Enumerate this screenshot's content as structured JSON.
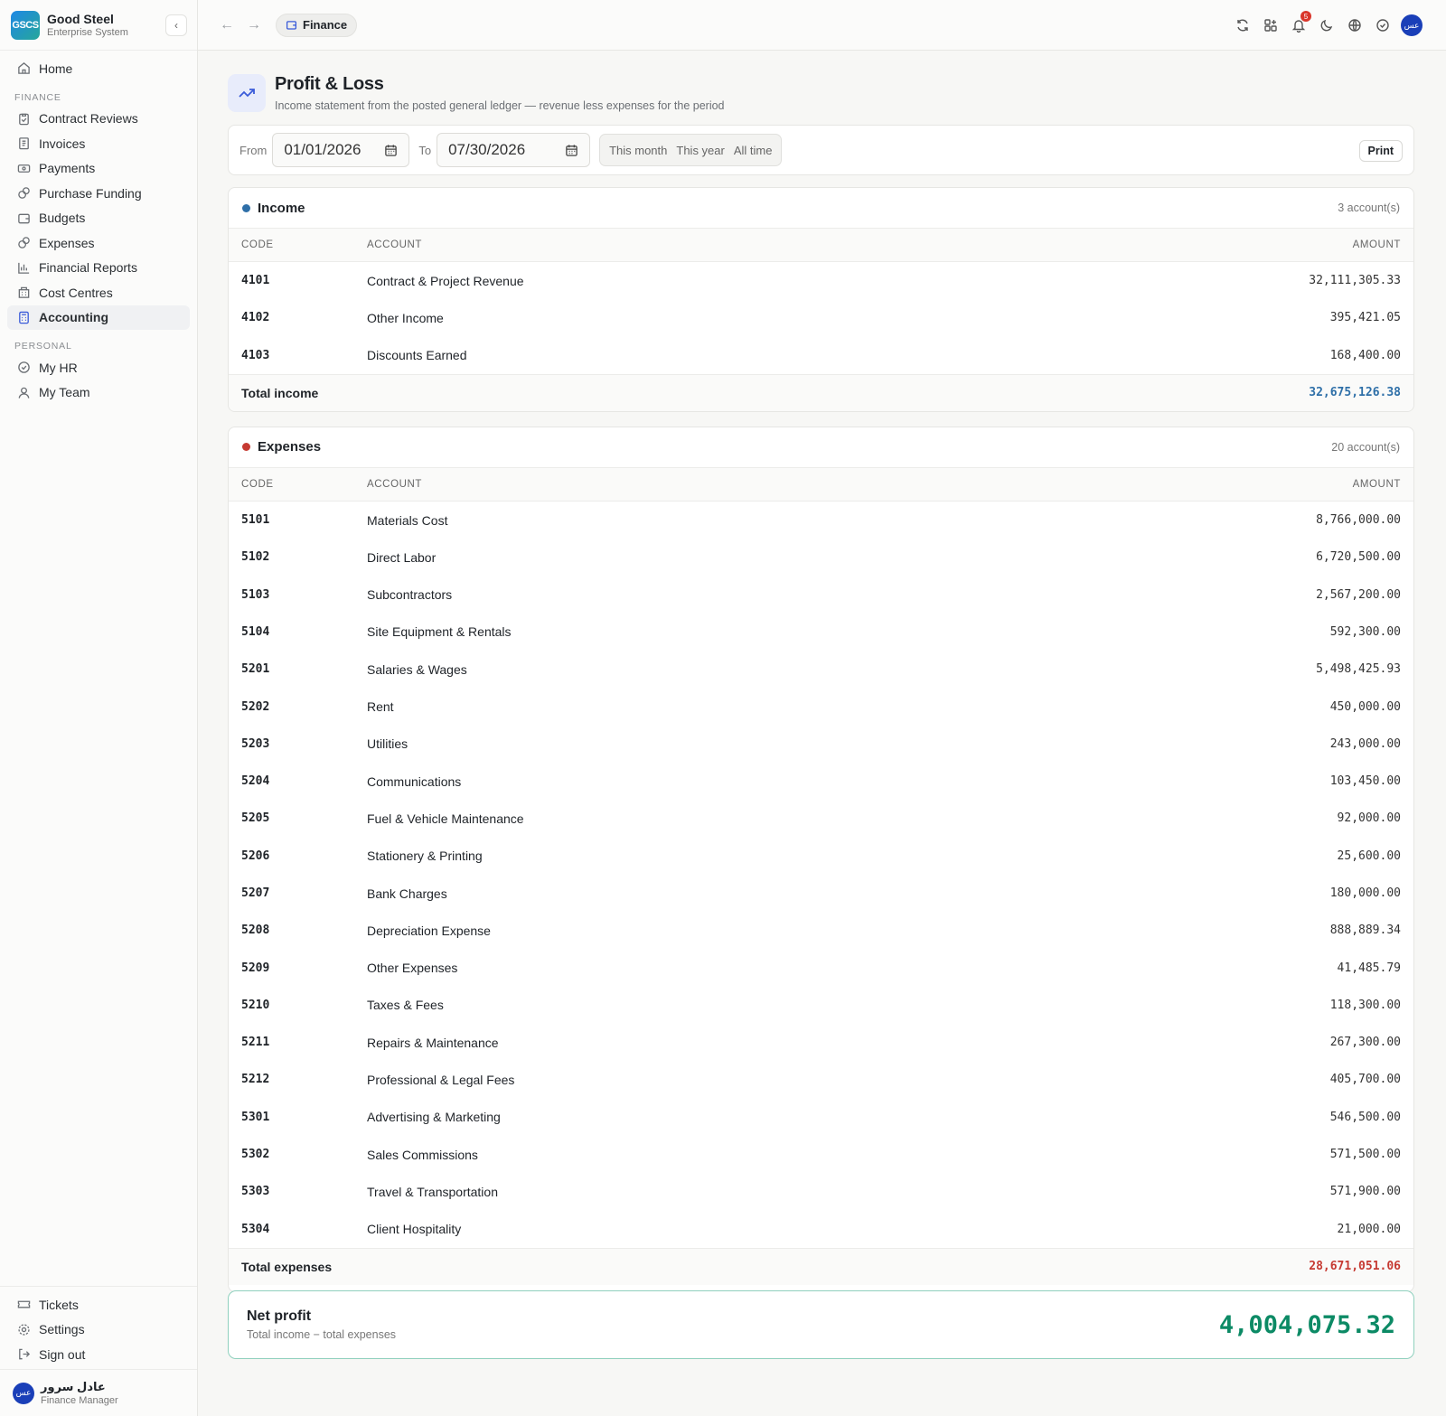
{
  "brand": {
    "logo": "GSCS",
    "name": "Good Steel",
    "subtitle": "Enterprise System"
  },
  "sidebar": {
    "home": "Home",
    "finance_section": "FINANCE",
    "finance_items": [
      {
        "label": "Contract Reviews",
        "icon": "clipboard-check-icon"
      },
      {
        "label": "Invoices",
        "icon": "invoice-icon"
      },
      {
        "label": "Payments",
        "icon": "payments-icon"
      },
      {
        "label": "Purchase Funding",
        "icon": "coins-icon"
      },
      {
        "label": "Budgets",
        "icon": "wallet-icon"
      },
      {
        "label": "Expenses",
        "icon": "coins-icon"
      },
      {
        "label": "Financial Reports",
        "icon": "bar-chart-icon"
      },
      {
        "label": "Cost Centres",
        "icon": "building-icon"
      },
      {
        "label": "Accounting",
        "icon": "calculator-icon"
      }
    ],
    "active": "Accounting",
    "personal_section": "PERSONAL",
    "personal_items": [
      {
        "label": "My HR",
        "icon": "check-circle-icon"
      },
      {
        "label": "My Team",
        "icon": "user-icon"
      }
    ],
    "bottom_items": [
      {
        "label": "Tickets",
        "icon": "ticket-icon"
      },
      {
        "label": "Settings",
        "icon": "gear-icon"
      },
      {
        "label": "Sign out",
        "icon": "sign-out-icon"
      }
    ],
    "user": {
      "initials": "عس",
      "name": "عادل سرور",
      "role": "Finance Manager"
    }
  },
  "topbar": {
    "module": "Finance",
    "notifications_count": "5",
    "avatar_initials": "عس"
  },
  "page": {
    "title": "Profit & Loss",
    "subtitle": "Income statement from the posted general ledger — revenue less expenses for the period"
  },
  "filters": {
    "from_label": "From",
    "from_value": "01/01/2026",
    "to_label": "To",
    "to_value": "07/30/2026",
    "presets": [
      "This month",
      "This year",
      "All time"
    ],
    "print_label": "Print"
  },
  "income": {
    "title": "Income",
    "count": "3 account(s)",
    "color": "#2e6fa8",
    "headers": {
      "code": "CODE",
      "account": "ACCOUNT",
      "amount": "AMOUNT"
    },
    "rows": [
      {
        "code": "4101",
        "account": "Contract & Project Revenue",
        "amount": "32,111,305.33"
      },
      {
        "code": "4102",
        "account": "Other Income",
        "amount": "395,421.05"
      },
      {
        "code": "4103",
        "account": "Discounts Earned",
        "amount": "168,400.00"
      }
    ],
    "total_label": "Total income",
    "total_value": "32,675,126.38",
    "total_color": "#2e6fa8"
  },
  "expenses": {
    "title": "Expenses",
    "count": "20 account(s)",
    "color": "#c63a32",
    "headers": {
      "code": "CODE",
      "account": "ACCOUNT",
      "amount": "AMOUNT"
    },
    "rows": [
      {
        "code": "5101",
        "account": "Materials Cost",
        "amount": "8,766,000.00"
      },
      {
        "code": "5102",
        "account": "Direct Labor",
        "amount": "6,720,500.00"
      },
      {
        "code": "5103",
        "account": "Subcontractors",
        "amount": "2,567,200.00"
      },
      {
        "code": "5104",
        "account": "Site Equipment & Rentals",
        "amount": "592,300.00"
      },
      {
        "code": "5201",
        "account": "Salaries & Wages",
        "amount": "5,498,425.93"
      },
      {
        "code": "5202",
        "account": "Rent",
        "amount": "450,000.00"
      },
      {
        "code": "5203",
        "account": "Utilities",
        "amount": "243,000.00"
      },
      {
        "code": "5204",
        "account": "Communications",
        "amount": "103,450.00"
      },
      {
        "code": "5205",
        "account": "Fuel & Vehicle Maintenance",
        "amount": "92,000.00"
      },
      {
        "code": "5206",
        "account": "Stationery & Printing",
        "amount": "25,600.00"
      },
      {
        "code": "5207",
        "account": "Bank Charges",
        "amount": "180,000.00"
      },
      {
        "code": "5208",
        "account": "Depreciation Expense",
        "amount": "888,889.34"
      },
      {
        "code": "5209",
        "account": "Other Expenses",
        "amount": "41,485.79"
      },
      {
        "code": "5210",
        "account": "Taxes & Fees",
        "amount": "118,300.00"
      },
      {
        "code": "5211",
        "account": "Repairs & Maintenance",
        "amount": "267,300.00"
      },
      {
        "code": "5212",
        "account": "Professional & Legal Fees",
        "amount": "405,700.00"
      },
      {
        "code": "5301",
        "account": "Advertising & Marketing",
        "amount": "546,500.00"
      },
      {
        "code": "5302",
        "account": "Sales Commissions",
        "amount": "571,500.00"
      },
      {
        "code": "5303",
        "account": "Travel & Transportation",
        "amount": "571,900.00"
      },
      {
        "code": "5304",
        "account": "Client Hospitality",
        "amount": "21,000.00"
      }
    ],
    "total_label": "Total expenses",
    "total_value": "28,671,051.06",
    "total_color": "#c63a32"
  },
  "net": {
    "title": "Net profit",
    "subtitle": "Total income − total expenses",
    "value": "4,004,075.32",
    "color": "#0c8a65"
  }
}
